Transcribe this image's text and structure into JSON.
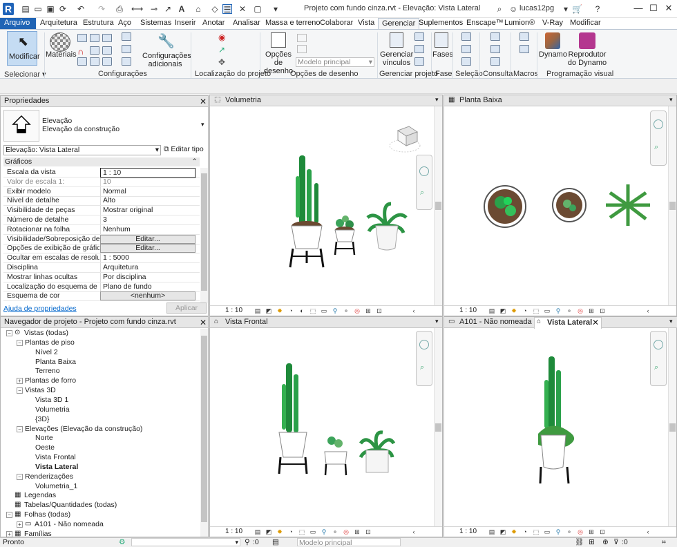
{
  "window": {
    "title": "Projeto com fundo cinza.rvt - Elevação: Vista Lateral",
    "user": "lucas12pg"
  },
  "tabs": [
    "Arquivo",
    "Arquitetura",
    "Estrutura",
    "Aço",
    "Sistemas",
    "Inserir",
    "Anotar",
    "Analisar",
    "Massa e terreno",
    "Colaborar",
    "Vista",
    "Gerenciar",
    "Suplementos",
    "Enscape™",
    "Lumion®",
    "V-Ray",
    "Modificar"
  ],
  "ribbon": {
    "modificar": "Modificar",
    "selecionar": "Selecionar",
    "materiais": "Materiais",
    "config_adicionais": "Configurações adicionais",
    "configuracoes": "Configurações",
    "localizacao": "Localização do projeto",
    "opcoes_desenho_btn": "Opções de desenho",
    "modelo_principal": "Modelo principal",
    "opcoes_desenho_panel": "Opções de desenho",
    "gerenciar_vinculos": "Gerenciar vínculos",
    "gerenciar_projeto": "Gerenciar projeto",
    "fases_btn": "Fases",
    "fase_panel": "Fase",
    "selecao": "Seleção",
    "consulta": "Consulta",
    "macros": "Macros",
    "dynamo": "Dynamo",
    "reprodutor": "Reprodutor do Dynamo",
    "programacao": "Programação visual"
  },
  "properties": {
    "title": "Propriedades",
    "type_line1": "Elevação",
    "type_line2": "Elevação da construção",
    "selector": "Elevação: Vista Lateral",
    "edit_type": "Editar tipo",
    "group": "Gráficos",
    "rows": [
      {
        "name": "Escala da vista",
        "value": "1 : 10"
      },
      {
        "name": "Valor de escala    1:",
        "value": "10"
      },
      {
        "name": "Exibir modelo",
        "value": "Normal"
      },
      {
        "name": "Nível de detalhe",
        "value": "Alto"
      },
      {
        "name": "Visibilidade de peças",
        "value": "Mostrar original"
      },
      {
        "name": "Número de detalhe",
        "value": "3"
      },
      {
        "name": "Rotacionar na folha",
        "value": "Nenhum"
      },
      {
        "name": "Visibilidade/Sobreposição de ...",
        "value": "Editar..."
      },
      {
        "name": "Opções de exibição de gráficos",
        "value": "Editar..."
      },
      {
        "name": "Ocultar em escalas de resoluç...",
        "value": "1 : 5000"
      },
      {
        "name": "Disciplina",
        "value": "Arquitetura"
      },
      {
        "name": "Mostrar linhas ocultas",
        "value": "Por disciplina"
      },
      {
        "name": "Localização do esquema de cor",
        "value": "Plano de fundo"
      },
      {
        "name": "Esquema de cor",
        "value": "<nenhum>"
      }
    ],
    "help": "Ajuda de propriedades",
    "apply": "Aplicar"
  },
  "browser": {
    "title": "Navegador de projeto - Projeto com fundo cinza.rvt",
    "nodes": [
      {
        "label": "Vistas (todas)"
      },
      {
        "label": "Plantas de piso"
      },
      {
        "label": "Nível 2"
      },
      {
        "label": "Planta Baixa"
      },
      {
        "label": "Terreno"
      },
      {
        "label": "Plantas de forro"
      },
      {
        "label": "Vistas 3D"
      },
      {
        "label": "Vista 3D 1"
      },
      {
        "label": "Volumetria"
      },
      {
        "label": "{3D}"
      },
      {
        "label": "Elevações (Elevação da construção)"
      },
      {
        "label": "Norte"
      },
      {
        "label": "Oeste"
      },
      {
        "label": "Vista Frontal"
      },
      {
        "label": "Vista Lateral"
      },
      {
        "label": "Renderizações"
      },
      {
        "label": "Volumetria_1"
      },
      {
        "label": "Legendas"
      },
      {
        "label": "Tabelas/Quantidades (todas)"
      },
      {
        "label": "Folhas (todas)"
      },
      {
        "label": "A101 - Não nomeada"
      },
      {
        "label": "Famílias"
      }
    ]
  },
  "views": {
    "volumetria": {
      "title": "Volumetria",
      "scale": "1 : 10"
    },
    "planta": {
      "title": "Planta Baixa",
      "scale": "1 : 10"
    },
    "frontal": {
      "title": "Vista Frontal",
      "scale": "1 : 10"
    },
    "a101": {
      "title": "A101 - Não nomeada"
    },
    "lateral": {
      "title": "Vista Lateral",
      "scale": "1 : 10"
    }
  },
  "status": {
    "text": "Pronto",
    "zero": ":0",
    "model": "Modelo principal",
    "filter": ":0"
  }
}
